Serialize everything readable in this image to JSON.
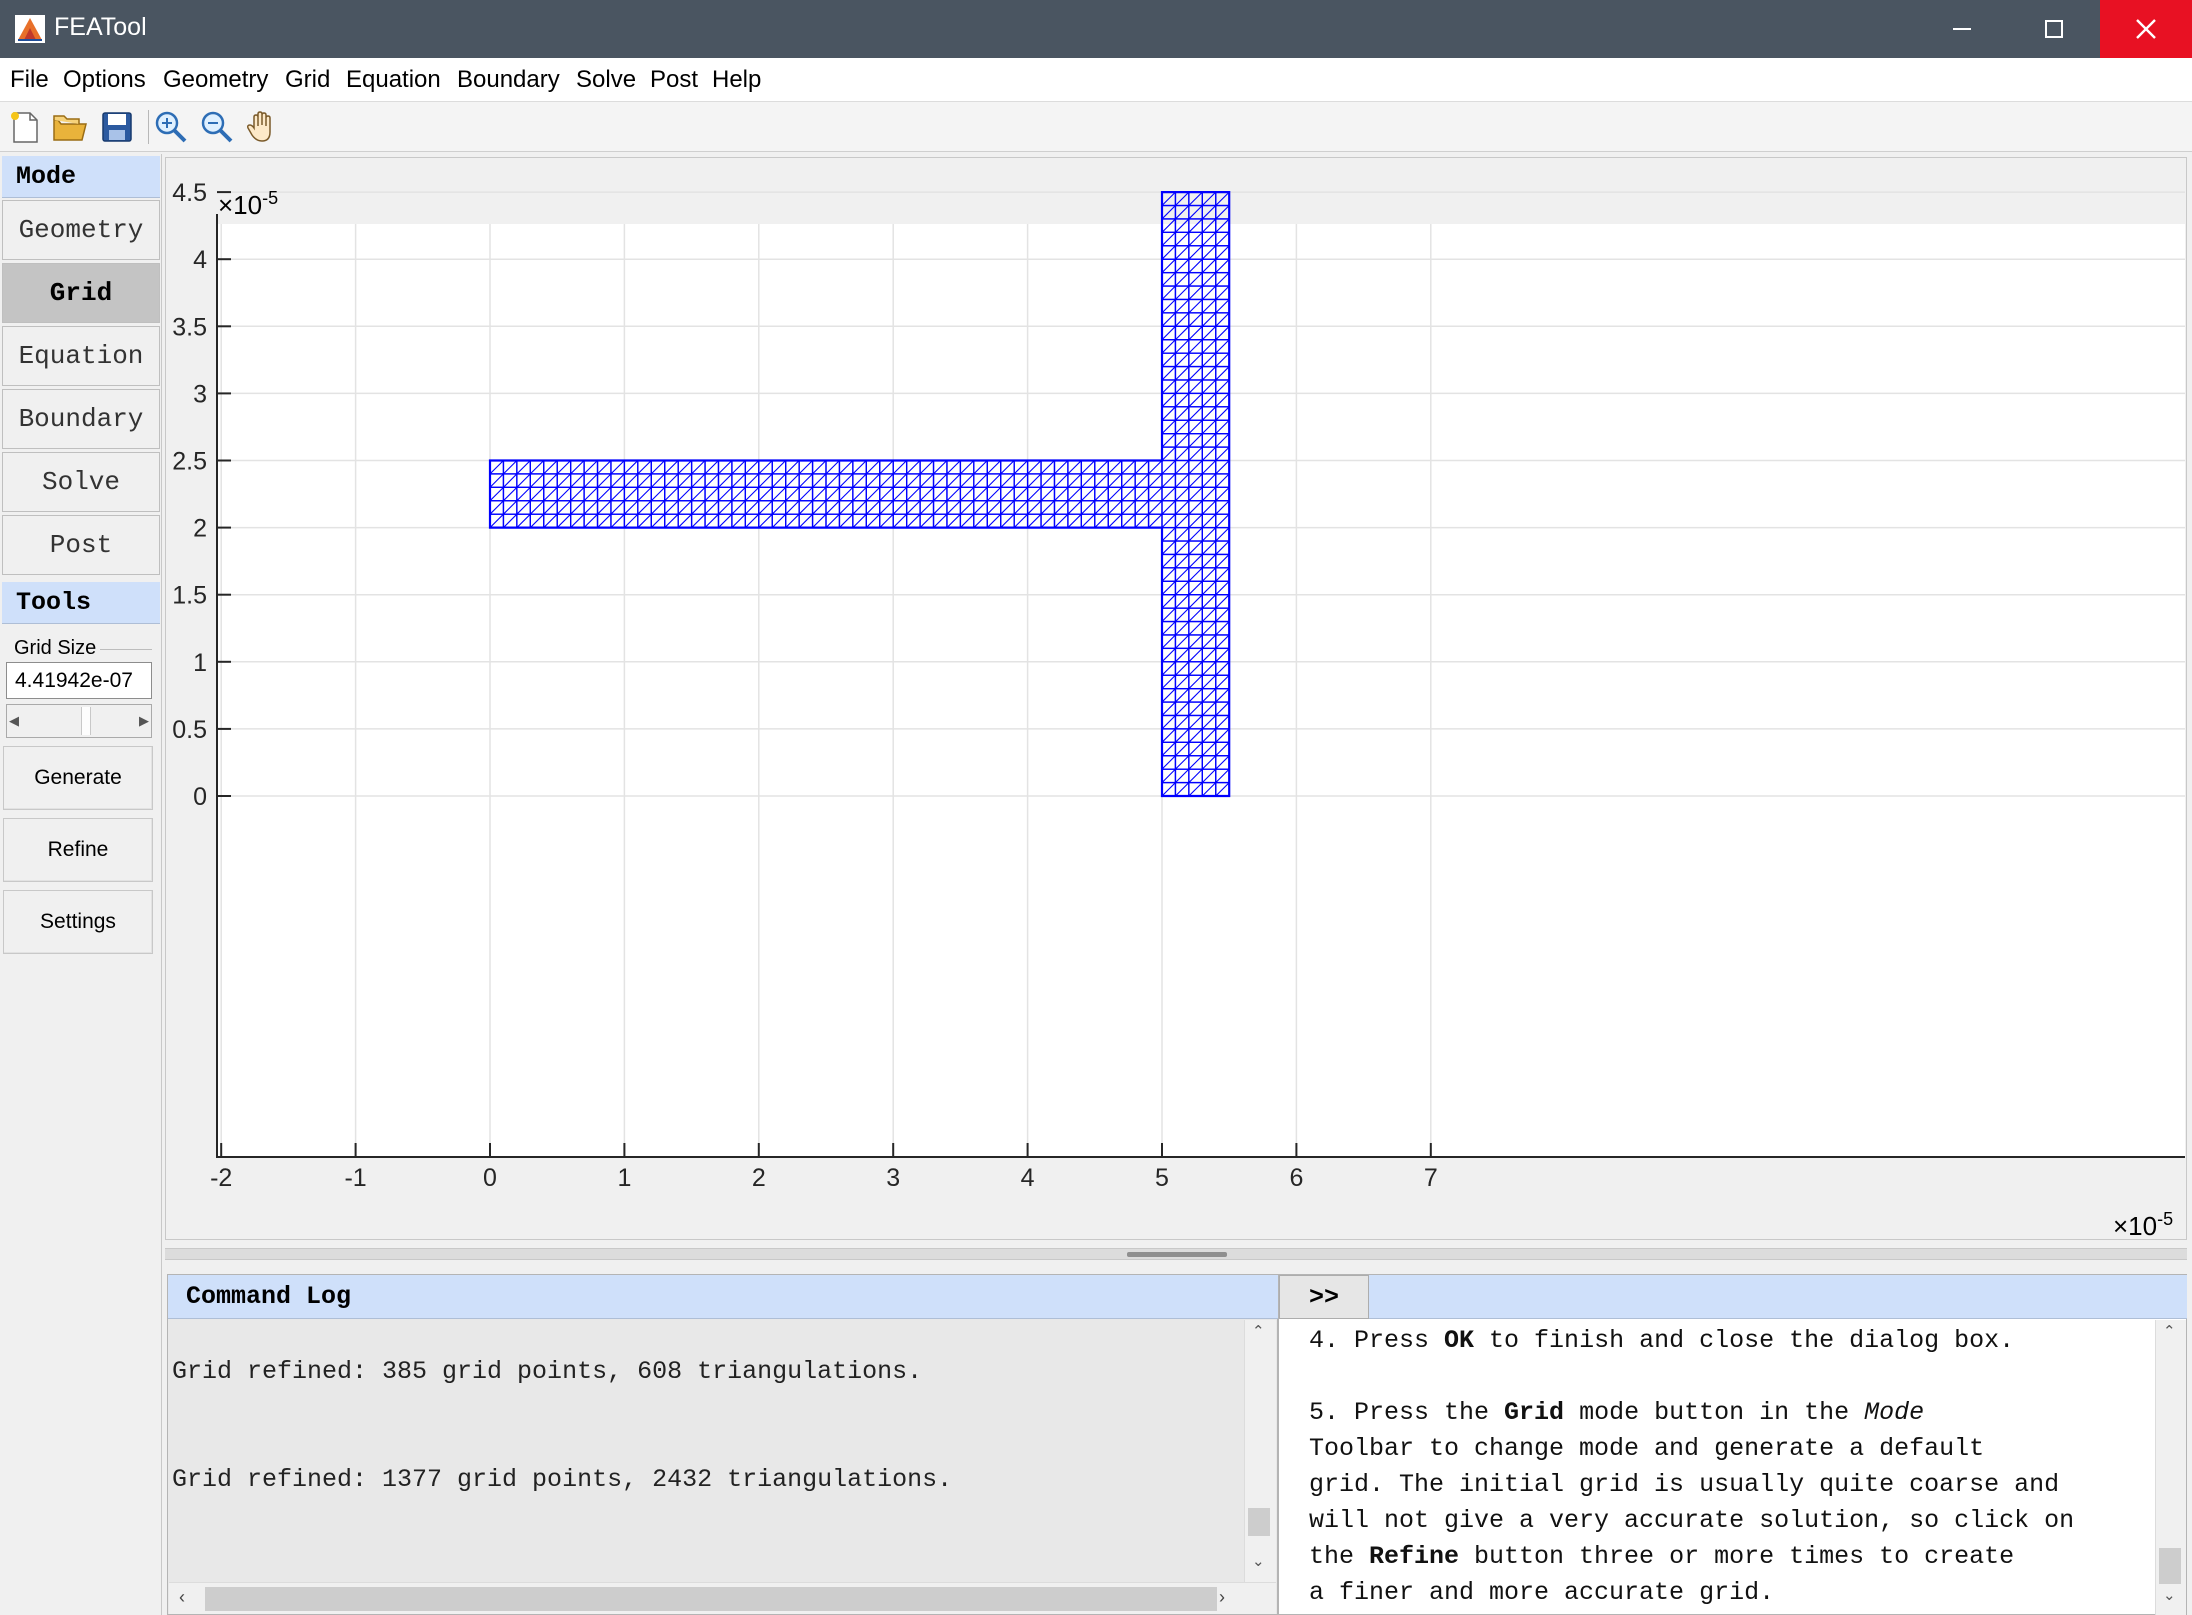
{
  "window": {
    "title": "FEATool",
    "minimize_icon": "minimize-icon",
    "maximize_icon": "maximize-icon",
    "close_icon": "close-icon"
  },
  "menu": {
    "items": [
      "File",
      "Options",
      "Geometry",
      "Grid",
      "Equation",
      "Boundary",
      "Solve",
      "Post",
      "Help"
    ]
  },
  "toolbar": {
    "icons": [
      "new-file-icon",
      "open-folder-icon",
      "save-icon",
      "zoom-in-icon",
      "zoom-out-icon",
      "pan-hand-icon"
    ]
  },
  "left_panel": {
    "mode_header": "Mode",
    "modes": [
      "Geometry",
      "Grid",
      "Equation",
      "Boundary",
      "Solve",
      "Post"
    ],
    "active_mode": "Grid",
    "tools_header": "Tools",
    "grid_size_label": "Grid Size",
    "grid_size_value": "4.41942e-07",
    "buttons": [
      "Generate",
      "Refine",
      "Settings"
    ]
  },
  "plot": {
    "x_multiplier": "×10",
    "x_exponent": "-5",
    "y_multiplier": "×10",
    "y_exponent": "-5",
    "mesh_color": "#0000ff",
    "grid_color": "#e3e3e3"
  },
  "chart_data": {
    "type": "mesh",
    "x_ticks": [
      "-2",
      "-1",
      "0",
      "1",
      "2",
      "3",
      "4",
      "5",
      "6",
      "7"
    ],
    "y_ticks": [
      "0",
      "0.5",
      "1",
      "1.5",
      "2",
      "2.5",
      "3",
      "3.5",
      "4",
      "4.5"
    ],
    "xlim": [
      -2.5,
      8
    ],
    "ylim": [
      -0.2,
      4.75
    ],
    "grid": true,
    "scale": "1e-5",
    "regions": [
      {
        "x": [
          0,
          5.5
        ],
        "y": [
          2,
          2.5
        ]
      },
      {
        "x": [
          5,
          5.5
        ],
        "y": [
          0,
          4.5
        ]
      }
    ],
    "mesh_spacing": 0.1
  },
  "command_log": {
    "header": "Command Log",
    "lines": [
      "Grid refined: 385 grid points, 608 triangulations.",
      "Grid refined: 1377 grid points, 2432 triangulations."
    ]
  },
  "help": {
    "expand_label": ">>",
    "step4": {
      "pre": "4. Press ",
      "bold": "OK",
      "post": " to finish and close the dialog box."
    },
    "step5_line1": {
      "pre": "5. Press the ",
      "bold": "Grid",
      "mid": " mode button in the ",
      "italic": "Mode"
    },
    "step5_line2": "Toolbar to change mode and generate a default",
    "step5_line3": "grid. The initial grid is usually quite coarse and",
    "step5_line4": "will not give a very accurate solution, so click on",
    "step5_line5": {
      "pre": "the ",
      "bold": "Refine",
      "post": " button three or more times to create"
    },
    "step5_line6": "a finer and more accurate grid."
  }
}
